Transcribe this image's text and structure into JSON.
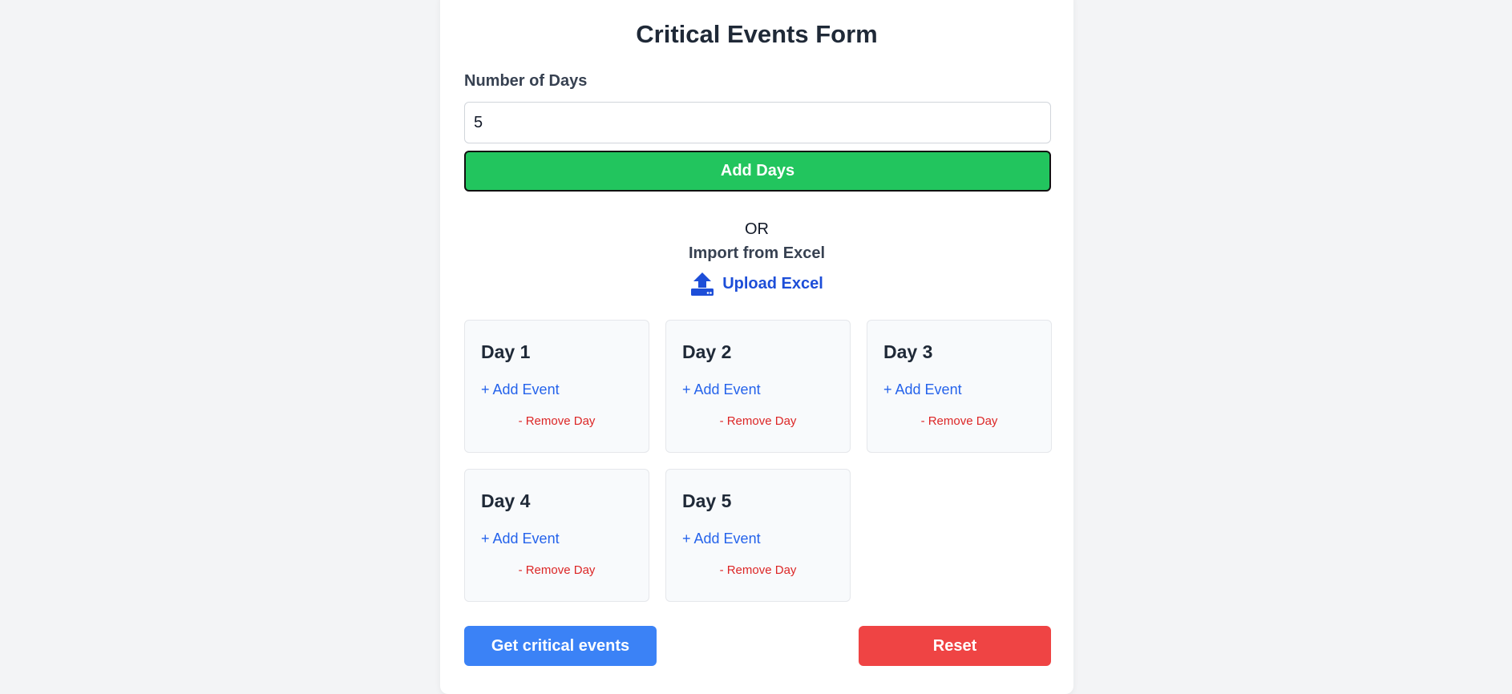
{
  "form": {
    "title": "Critical Events Form",
    "days_label": "Number of Days",
    "days_value": "5",
    "add_days_label": "Add Days",
    "or_text": "OR",
    "import_text": "Import from Excel",
    "upload_label": "Upload Excel"
  },
  "days": [
    {
      "title": "Day 1",
      "add_event": "+ Add Event",
      "remove_day": "- Remove Day"
    },
    {
      "title": "Day 2",
      "add_event": "+ Add Event",
      "remove_day": "- Remove Day"
    },
    {
      "title": "Day 3",
      "add_event": "+ Add Event",
      "remove_day": "- Remove Day"
    },
    {
      "title": "Day 4",
      "add_event": "+ Add Event",
      "remove_day": "- Remove Day"
    },
    {
      "title": "Day 5",
      "add_event": "+ Add Event",
      "remove_day": "- Remove Day"
    }
  ],
  "actions": {
    "get_events_label": "Get critical events",
    "reset_label": "Reset"
  },
  "colors": {
    "add_days": "#22c55e",
    "primary": "#3b82f6",
    "danger": "#ef4444",
    "link": "#1d4ed8"
  },
  "icons": {
    "upload": "upload-icon"
  }
}
